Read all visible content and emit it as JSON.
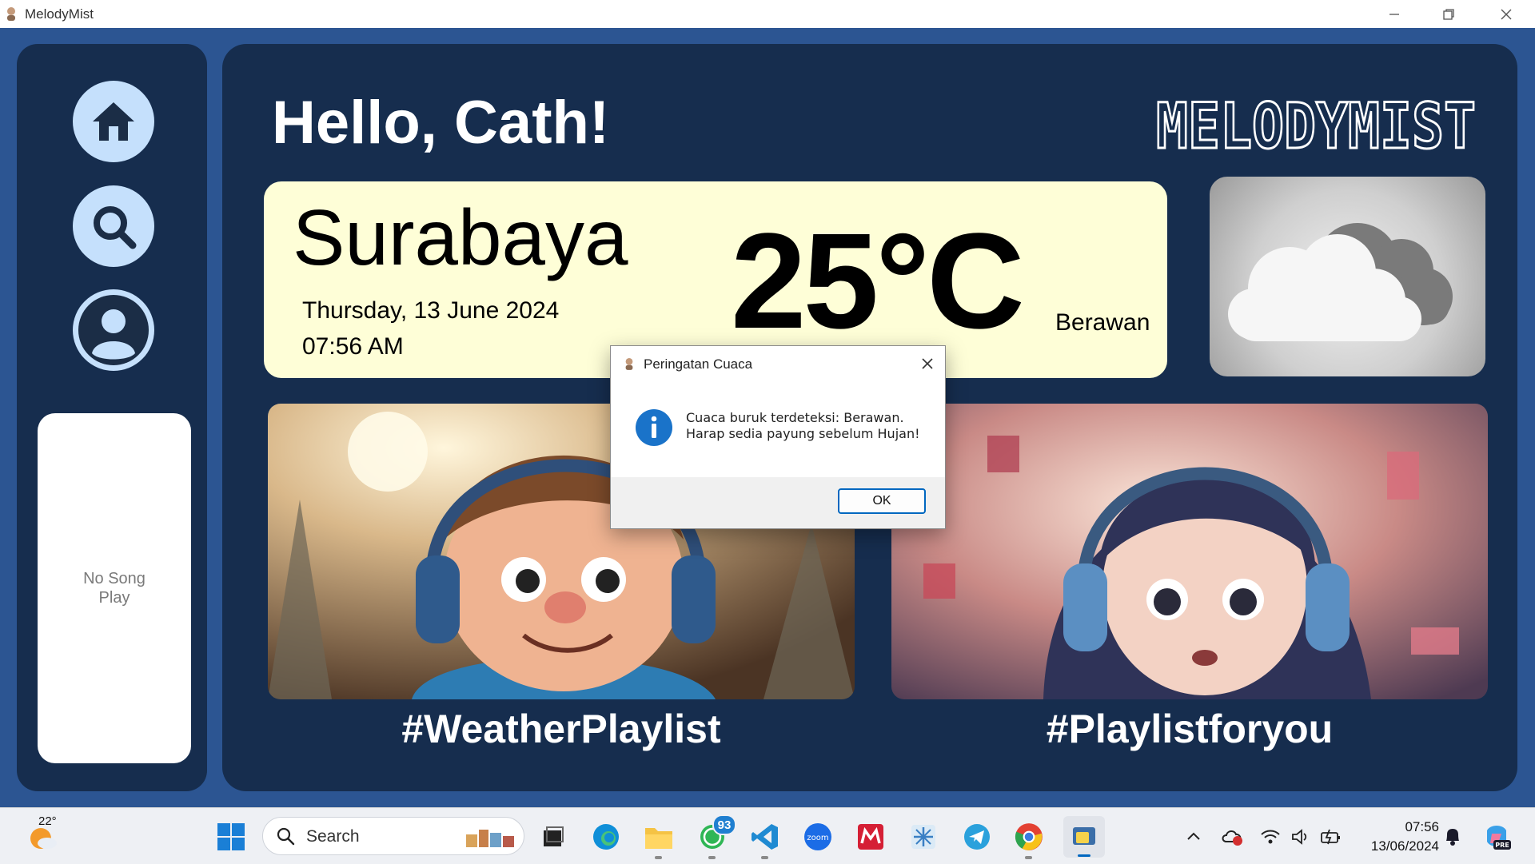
{
  "window": {
    "title": "MelodyMist"
  },
  "sidebar": {
    "nav": [
      {
        "name": "home",
        "icon": "home-icon"
      },
      {
        "name": "search",
        "icon": "search-icon"
      },
      {
        "name": "profile",
        "icon": "user-icon"
      }
    ],
    "player_text": "No Song Play"
  },
  "main": {
    "greeting": "Hello, Cath!",
    "logo_text": "MELODYMIST",
    "weather": {
      "city": "Surabaya",
      "date": "Thursday, 13 June 2024",
      "time": "07:56 AM",
      "temperature": "25°C",
      "condition": "Berawan",
      "icon": "cloud-icon"
    },
    "playlists": [
      {
        "label": "#WeatherPlaylist"
      },
      {
        "label": "#Playlistforyou"
      }
    ]
  },
  "dialog": {
    "title": "Peringatan Cuaca",
    "message_line1": "Cuaca buruk terdeteksi: Berawan.",
    "message_line2": "Harap sedia payung sebelum Hujan!",
    "ok_label": "OK",
    "icon": "info-icon"
  },
  "taskbar": {
    "weather_temp": "22°",
    "search_placeholder": "Search",
    "whatsapp_badge": "93",
    "zoom_label": "zoom",
    "clock_time": "07:56",
    "clock_date": "13/06/2024",
    "copilot_label": "PRE"
  },
  "colors": {
    "app_bg": "#2c5592",
    "panel": "#162d4e",
    "nav_button": "#c5e0fc",
    "weather_card": "#fefed7",
    "accent_blue": "#0067c0"
  }
}
